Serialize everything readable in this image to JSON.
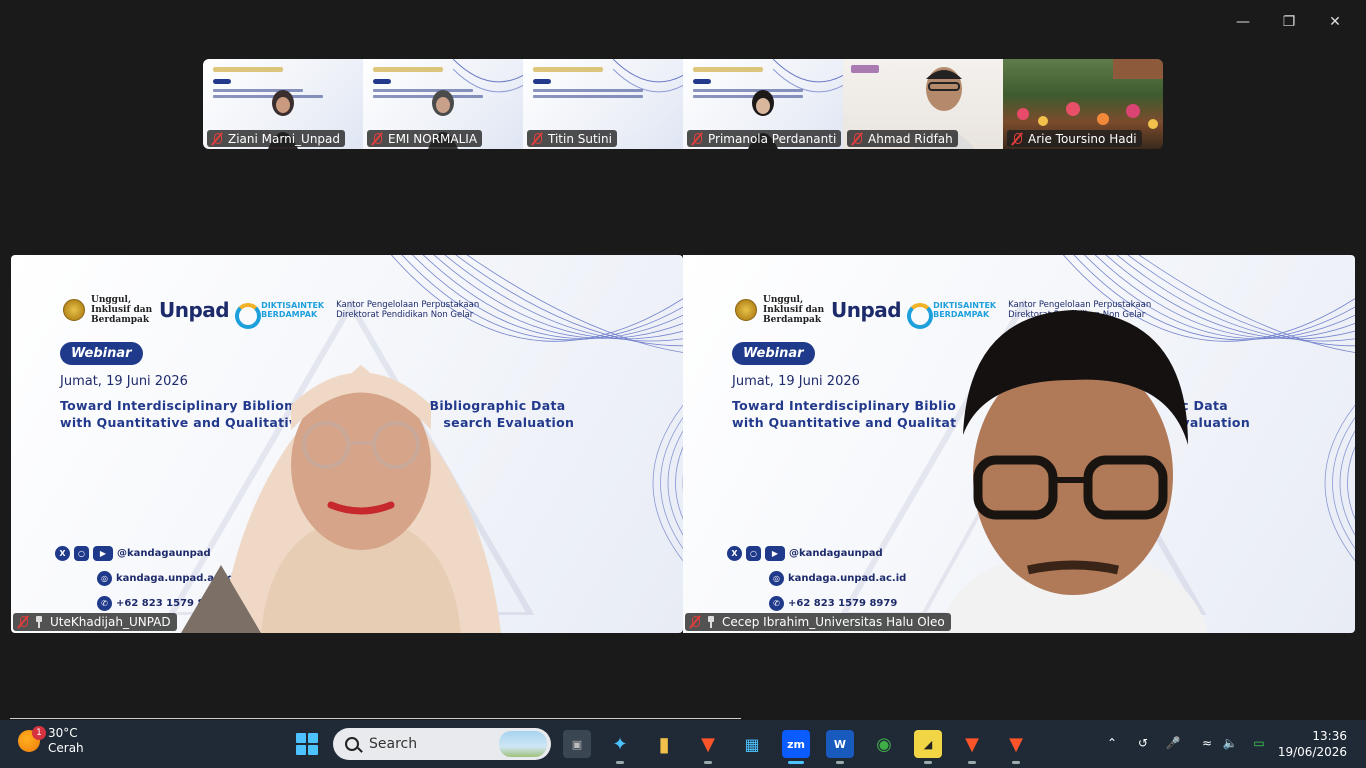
{
  "participants": [
    {
      "name": "Ziani Marni_Unpad",
      "kind": "slide"
    },
    {
      "name": "EMI NORMALIA",
      "kind": "slide"
    },
    {
      "name": "Titin Sutini",
      "kind": "slide"
    },
    {
      "name": "Primanola Perdananti",
      "kind": "slide"
    },
    {
      "name": "Ahmad Ridfah",
      "kind": "camera"
    },
    {
      "name": "Arie Toursino Hadi",
      "kind": "camera"
    }
  ],
  "slide": {
    "tagline": "Unggul, Inklusif dan Berdampak",
    "brand": "Unpad",
    "dikti_line1": "DIKTISAINTEK",
    "dikti_line2": "BERDAMPAK",
    "office_line1": "Kantor Pengelolaan Perpustakaan",
    "office_line2": "Direktorat Pendidikan Non Gelar",
    "pill": "Webinar",
    "date": "Jumat, 19 Juni 2026",
    "title_line1": "Toward Interdisciplinary Bibliom",
    "title_line1b": "Bibliographic Data",
    "title_line2": "with Quantitative and Qualitativ",
    "title_line2b": "search Evaluation",
    "title_r_line1": "Toward Interdisciplinary Biblio",
    "title_r_line1b": "c Data",
    "title_r_line2": "with Quantitative and Qualitat",
    "title_r_line2b": "valuation",
    "social": "@kandagaunpad",
    "website": "kandaga.unpad.ac.id",
    "phone": "+62 823 1579 8979",
    "phone_left": "+62 823 1579 8"
  },
  "main_left": {
    "name": "UteKhadijah_UNPAD"
  },
  "main_right": {
    "name": "Cecep Ibrahim_Universitas Halu Oleo"
  },
  "taskbar": {
    "temperature": "30°C",
    "weather": "Cerah",
    "notif_count": "1",
    "search_label": "Search",
    "time": "13:36",
    "date": "19/06/2026"
  },
  "colors": {
    "accent": "#1f3a8a",
    "mute": "#e03d3d",
    "taskbar": "#1f2a36"
  }
}
